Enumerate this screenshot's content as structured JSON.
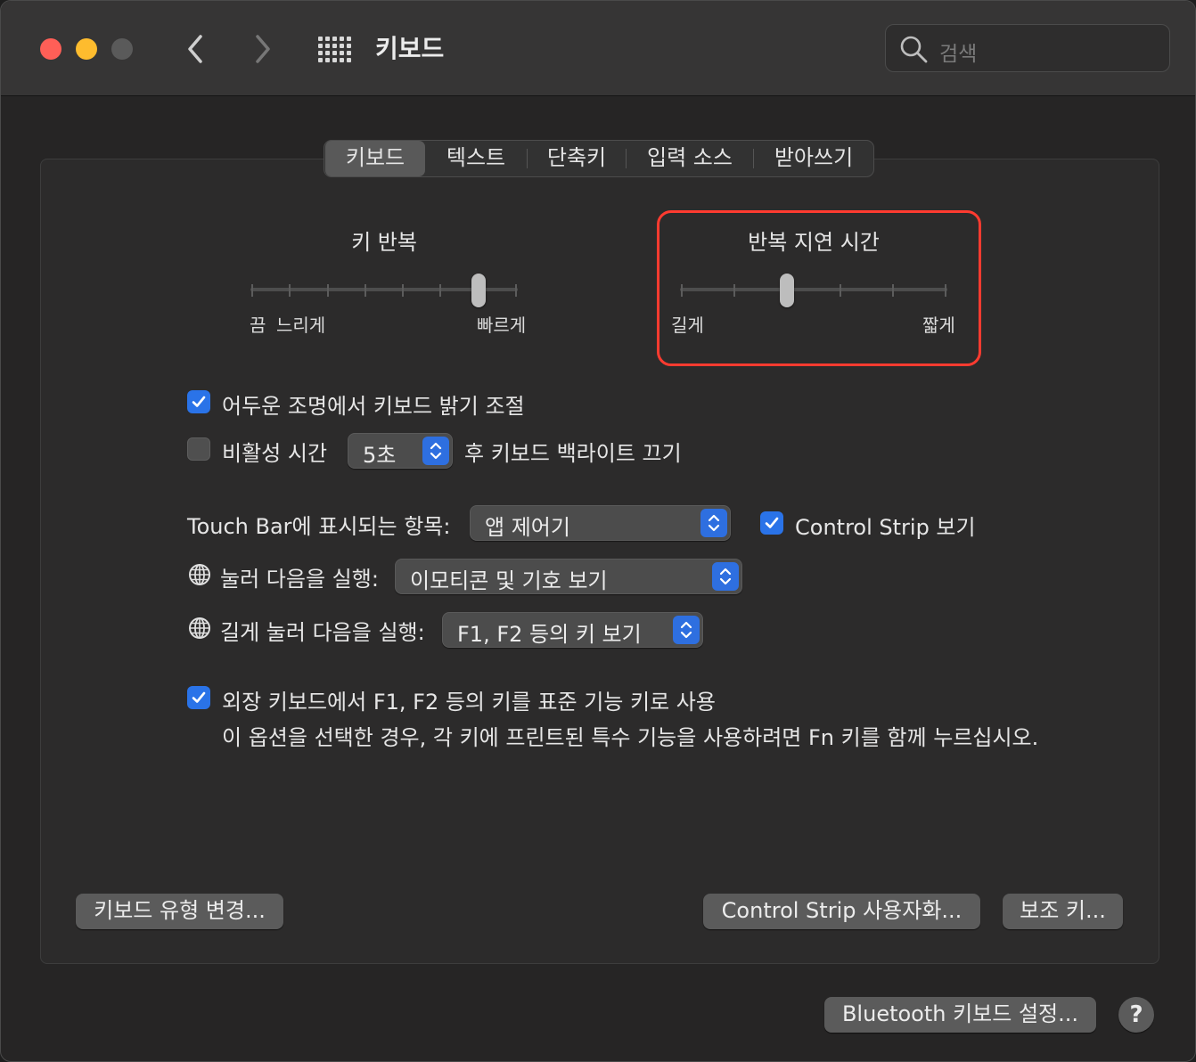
{
  "window": {
    "title": "키보드"
  },
  "search": {
    "placeholder": "검색"
  },
  "tabs": [
    {
      "label": "키보드",
      "selected": true
    },
    {
      "label": "텍스트"
    },
    {
      "label": "단축키"
    },
    {
      "label": "입력 소스"
    },
    {
      "label": "받아쓰기"
    }
  ],
  "key_repeat": {
    "title": "키 반복",
    "label_off": "끔",
    "label_slow": "느리게",
    "label_fast": "빠르게",
    "ticks": 8,
    "value_index": 6
  },
  "repeat_delay": {
    "title": "반복 지연 시간",
    "label_long": "길게",
    "label_short": "짧게",
    "ticks": 6,
    "value_index": 2
  },
  "options": {
    "adjust_brightness": {
      "label": "어두운 조명에서 키보드 밝기 조절",
      "checked": true
    },
    "backlight_off": {
      "label_before": "비활성 시간",
      "value": "5초",
      "label_after": "후 키보드 백라이트 끄기",
      "checked": false
    },
    "touch_bar": {
      "label": "Touch Bar에 표시되는 항목:",
      "value": "앱 제어기"
    },
    "control_strip": {
      "label": "Control Strip 보기",
      "checked": true
    },
    "press_globe": {
      "label": "눌러 다음을 실행:",
      "value": "이모티콘 및 기호 보기"
    },
    "hold_globe": {
      "label": "길게 눌러 다음을 실행:",
      "value": "F1, F2 등의 키 보기"
    },
    "fn_keys": {
      "label": "외장 키보드에서 F1, F2 등의 키를 표준 기능 키로 사용",
      "description": "이 옵션을 선택한 경우, 각 키에 프린트된 특수 기능을 사용하려면 Fn 키를 함께 누르십시오.",
      "checked": true
    }
  },
  "buttons": {
    "change_type": "키보드 유형 변경...",
    "customize_strip": "Control Strip 사용자화...",
    "modifier_keys": "보조 키...",
    "bluetooth": "Bluetooth 키보드 설정...",
    "help": "?"
  },
  "colors": {
    "accent": "#2a73e8",
    "highlight": "#ff3b30"
  }
}
